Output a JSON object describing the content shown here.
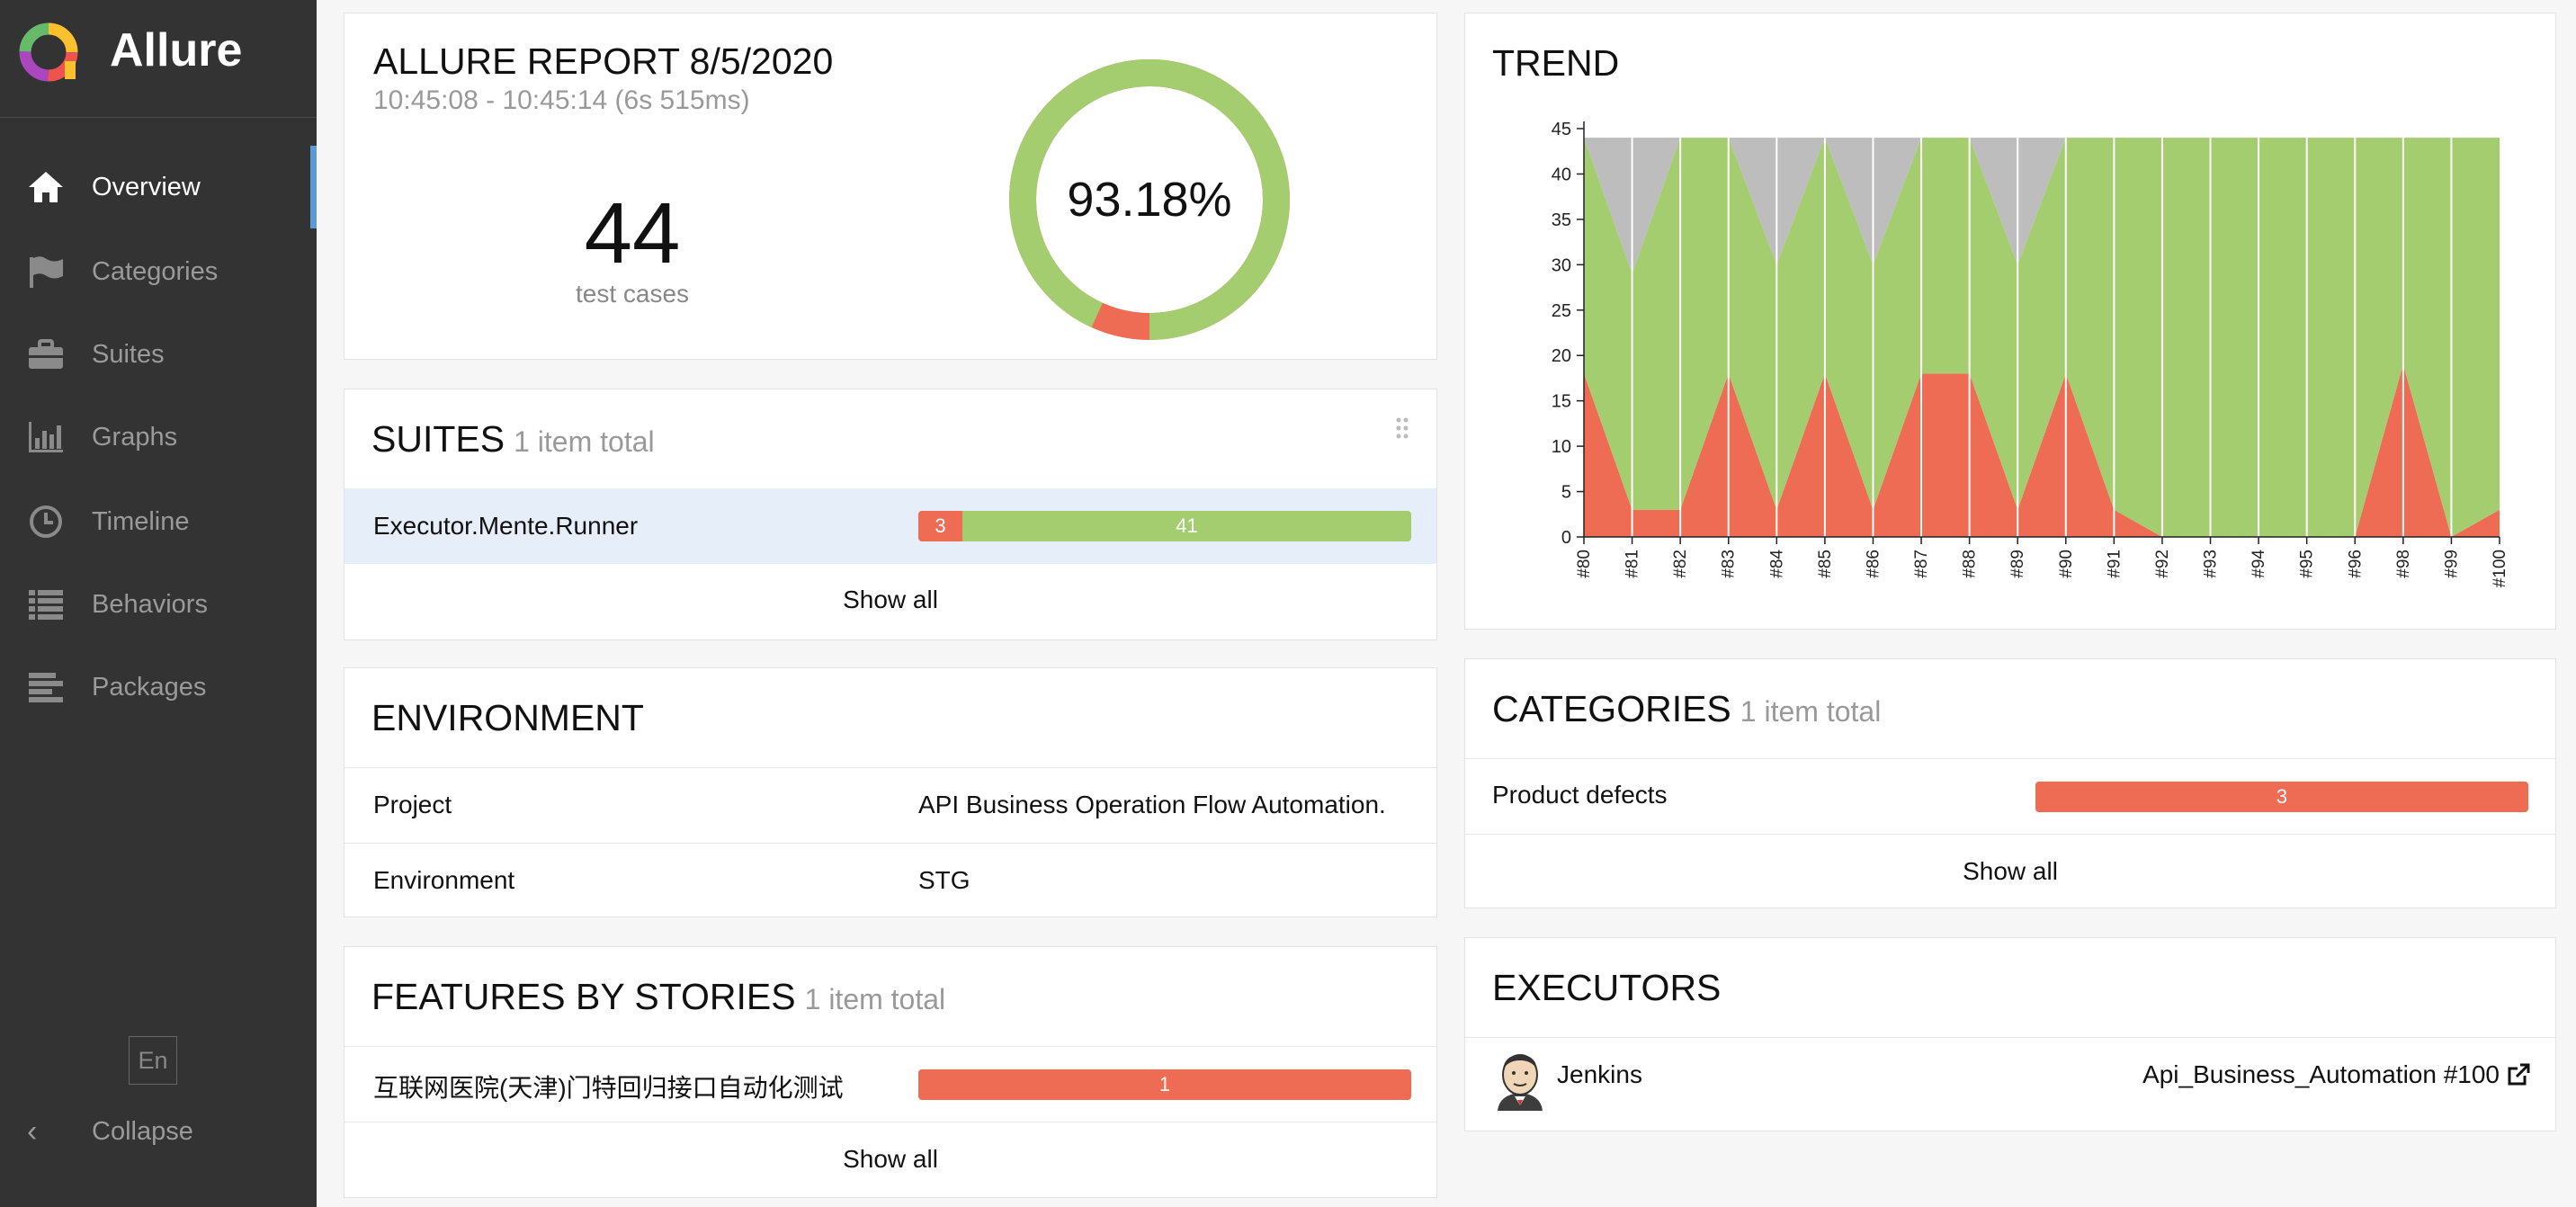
{
  "app": {
    "name": "Allure"
  },
  "sidebar": {
    "items": [
      {
        "label": "Overview",
        "icon": "home-icon"
      },
      {
        "label": "Categories",
        "icon": "flag-icon"
      },
      {
        "label": "Suites",
        "icon": "briefcase-icon"
      },
      {
        "label": "Graphs",
        "icon": "bar-chart-icon"
      },
      {
        "label": "Timeline",
        "icon": "clock-icon"
      },
      {
        "label": "Behaviors",
        "icon": "list-icon"
      },
      {
        "label": "Packages",
        "icon": "align-left-icon"
      }
    ],
    "language": "En",
    "collapse": "Collapse"
  },
  "summary": {
    "title": "ALLURE REPORT 8/5/2020",
    "time": "10:45:08 - 10:45:14 (6s 515ms)",
    "count": "44",
    "count_label": "test cases",
    "percent": "93.18%",
    "pass_fraction": 0.9318
  },
  "suites": {
    "title": "SUITES",
    "subtitle": "1 item total",
    "rows": [
      {
        "name": "Executor.Mente.Runner",
        "failed": 3,
        "passed": 41
      }
    ],
    "show_all": "Show all"
  },
  "environment": {
    "title": "ENVIRONMENT",
    "rows": [
      {
        "key": "Project",
        "value": "API Business Operation Flow Automation."
      },
      {
        "key": "Environment",
        "value": "STG"
      }
    ]
  },
  "features": {
    "title": "FEATURES BY STORIES",
    "subtitle": "1 item total",
    "rows": [
      {
        "name": "互联网医院(天津)门特回归接口自动化测试",
        "failed": 1
      }
    ],
    "show_all": "Show all"
  },
  "trend": {
    "title": "TREND"
  },
  "categories": {
    "title": "CATEGORIES",
    "subtitle": "1 item total",
    "rows": [
      {
        "name": "Product defects",
        "count": 3
      }
    ],
    "show_all": "Show all"
  },
  "executors": {
    "title": "EXECUTORS",
    "rows": [
      {
        "name": "Jenkins",
        "build": "Api_Business_Automation #100"
      }
    ]
  },
  "colors": {
    "failed": "#ee6b54",
    "passed": "#a3cd6f",
    "unknown": "#bdbdbd",
    "sidebar": "#333333",
    "accent": "#5b9bd5"
  },
  "chart_data": {
    "type": "area",
    "title": "TREND",
    "x": [
      "#80",
      "#81",
      "#82",
      "#83",
      "#84",
      "#85",
      "#86",
      "#87",
      "#88",
      "#89",
      "#90",
      "#91",
      "#92",
      "#93",
      "#94",
      "#95",
      "#96",
      "#98",
      "#99",
      "#100"
    ],
    "ylim": [
      0,
      45
    ],
    "yticks": [
      0,
      5,
      10,
      15,
      20,
      25,
      30,
      35,
      40,
      45
    ],
    "series": [
      {
        "color": "#ee6b54",
        "values": [
          18,
          3,
          3,
          18,
          3,
          18,
          3,
          18,
          18,
          3,
          18,
          3,
          0,
          0,
          0,
          0,
          0,
          19,
          0,
          3
        ]
      },
      {
        "color": "#a3cd6f",
        "values": [
          26,
          26,
          41,
          26,
          27,
          26,
          27,
          26,
          26,
          27,
          26,
          41,
          44,
          44,
          44,
          44,
          44,
          25,
          44,
          41
        ]
      },
      {
        "color": "#bdbdbd",
        "values": [
          0,
          15,
          0,
          0,
          14,
          0,
          14,
          0,
          0,
          14,
          0,
          0,
          0,
          0,
          0,
          0,
          0,
          0,
          0,
          0
        ]
      }
    ]
  }
}
